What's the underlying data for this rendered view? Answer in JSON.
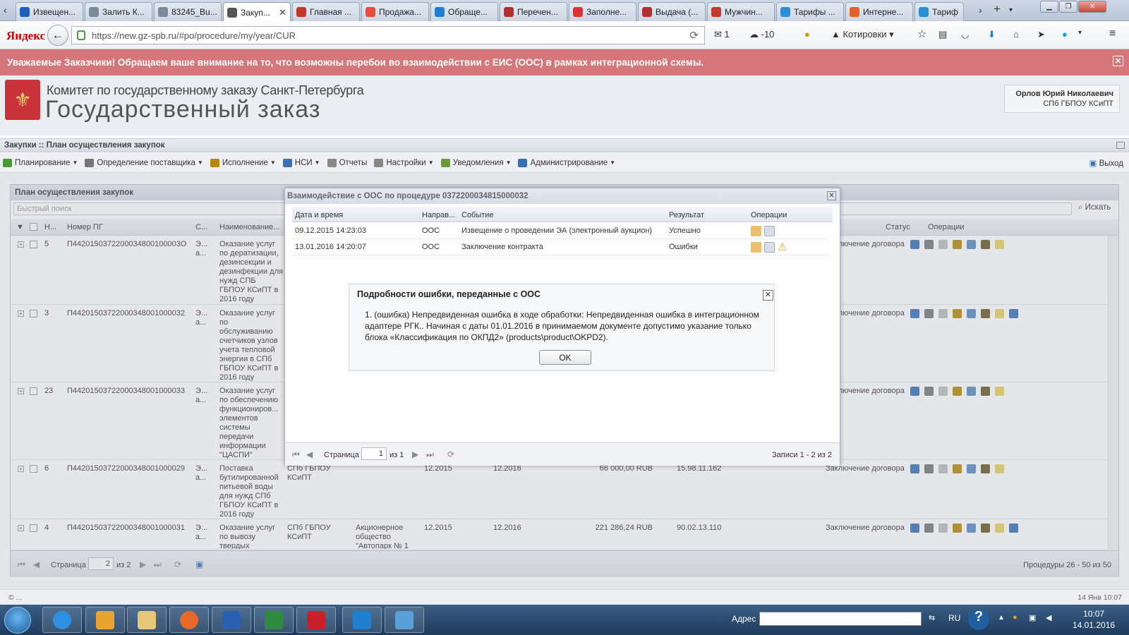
{
  "browser": {
    "tabs": [
      {
        "label": "Извещен...",
        "color": "#1f5fbf"
      },
      {
        "label": "Залить К...",
        "color": "#7a8a99"
      },
      {
        "label": "83245_Bu...",
        "color": "#7a8a99"
      },
      {
        "label": "Закуп...",
        "color": "#555"
      },
      {
        "label": "Главная ...",
        "color": "#c0392b"
      },
      {
        "label": "Продажа...",
        "color": "#e74c3c"
      },
      {
        "label": "Обраще...",
        "color": "#1f7fd1"
      },
      {
        "label": "Перечен...",
        "color": "#b03030"
      },
      {
        "label": "Заполне...",
        "color": "#d33"
      },
      {
        "label": "Выдача (...",
        "color": "#b03030"
      },
      {
        "label": "Мужчин...",
        "color": "#c0392b"
      },
      {
        "label": "Тарифы ...",
        "color": "#2a8fd4"
      },
      {
        "label": "Интерне...",
        "color": "#e0622a"
      },
      {
        "label": "Тариф",
        "color": "#2a8fd4"
      }
    ],
    "url": "https://new.gz-spb.ru/#po/procedure/my/year/CUR",
    "url_host": "new.gz-spb.ru",
    "brand": "Яндекс",
    "toolbar": {
      "mail_count": "1",
      "weather": "-10",
      "quotes": "Котировки"
    }
  },
  "banner": {
    "text": "Уважаемые Заказчики! Обращаем ваше внимание на то, что возможны перебои во взаимодействии с ЕИС (ООС) в рамках интеграционной схемы."
  },
  "header": {
    "org_line1": "Комитет по государственному заказу Санкт-Петербурга",
    "org_line2": "Государственный заказ",
    "user_name": "Орлов Юрий Николаевич",
    "user_org": "СПб ГБПОУ КСиПТ"
  },
  "breadcrumb": "Закупки :: План осуществления закупок",
  "menu": [
    {
      "label": "Планирование",
      "dropdown": true,
      "color": "#4a9a3a"
    },
    {
      "label": "Определение поставщика",
      "dropdown": true,
      "color": "#777"
    },
    {
      "label": "Исполнение",
      "dropdown": true,
      "color": "#b8860b"
    },
    {
      "label": "НСИ",
      "dropdown": true,
      "color": "#3a6fb0"
    },
    {
      "label": "Отчеты",
      "dropdown": false,
      "color": "#888"
    },
    {
      "label": "Настройки",
      "dropdown": true,
      "color": "#888"
    },
    {
      "label": "Уведомления",
      "dropdown": true,
      "color": "#6a9a3a"
    },
    {
      "label": "Администрирование",
      "dropdown": true,
      "color": "#3a6fb0"
    }
  ],
  "exit_label": "Выход",
  "main": {
    "title": "План осуществления закупок",
    "search_placeholder": "Быстрый поиск",
    "search_button": "Искать",
    "columns": {
      "n": "Н...",
      "pg": "Номер ПГ",
      "s": "С...",
      "name": "Наименование...",
      "status": "Статус",
      "ops": "Операции"
    },
    "rows": [
      {
        "n": "5",
        "pg": "П4420150372200034800100003О",
        "s": "Э... а...",
        "name": "Оказание услуг по дератизации, дезинсекции и дезинфекции для нужд СПБ ГБПОУ КСиПТ в 2016 году",
        "cust": "",
        "supplier": "",
        "start": "",
        "end": "",
        "sum": "",
        "okpd": "",
        "status": "Заключение договора",
        "extra_icon": false
      },
      {
        "n": "3",
        "pg": "П44201503722000348001000032",
        "s": "Э... а...",
        "name": "Оказание услуг по обслуживанию счетчиков узлов учета тепловой энергии в СПб ГБПОУ КСиПТ в 2016 году",
        "cust": "",
        "supplier": "",
        "start": "",
        "end": "",
        "sum": "",
        "okpd": "",
        "status": "Заключение договора",
        "extra_icon": true
      },
      {
        "n": "23",
        "pg": "П44201503722000348001000033",
        "s": "Э... а...",
        "name": "Оказание услуг по обеспечению функциониров... элементов системы передачи информации \"ЦАСПИ\"",
        "cust": "",
        "supplier": "",
        "start": "",
        "end": "",
        "sum": "",
        "okpd": "",
        "status": "Заключение договора",
        "extra_icon": false
      },
      {
        "n": "6",
        "pg": "П44201503722000348001000029",
        "s": "Э... а...",
        "name": "Поставка бутилированной питьевой воды для нужд СПб ГБПОУ КСиПТ в 2016 году",
        "cust": "СПб ГБПОУ КСиПТ",
        "supplier": "",
        "start": "12.2015",
        "end": "12.2016",
        "sum": "66 000,00 RUB",
        "okpd": "15.98.11.162",
        "status": "Заключение договора",
        "extra_icon": false
      },
      {
        "n": "4",
        "pg": "П44201503722000348001000031",
        "s": "Э... а...",
        "name": "Оказание услуг по вывозу твердых",
        "cust": "СПб ГБПОУ КСиПТ",
        "supplier": "Акционерное общество \"Автопарк № 1",
        "start": "12.2015",
        "end": "12.2016",
        "sum": "221 286,24 RUB",
        "okpd": "90.02.13.110",
        "status": "Заключение договора",
        "extra_icon": true
      }
    ],
    "pager": {
      "page_label": "Страница",
      "page": "2",
      "of": "из 2",
      "records": "Процедуры 26 - 50 из 50"
    }
  },
  "interaction": {
    "title": "Взаимодействие с ООС по процедуре 0372200034815000032",
    "columns": {
      "dt": "Дата и время",
      "dir": "Направ...",
      "event": "Событие",
      "result": "Результат",
      "ops": "Операции"
    },
    "rows": [
      {
        "dt": "09.12.2015 14:23:03",
        "dir": "ООС",
        "event": "Извещение о проведении ЭА (электронный аукцион)",
        "result": "Успешно",
        "warn": false
      },
      {
        "dt": "13.01.2016 14:20:07",
        "dir": "ООС",
        "event": "Заключение контракта",
        "result": "Ошибки",
        "warn": true
      }
    ],
    "pager": {
      "page_label": "Страница",
      "page": "1",
      "of": "из 1",
      "records": "Записи 1 - 2 из 2"
    }
  },
  "error_dialog": {
    "title": "Подробности ошибки, переданные с ООС",
    "text": "1. (ошибка) Непредвиденная ошибка в ходе обработки: Непредвиденная ошибка в интеграционном адаптере РГК.. Начиная с даты 01.01.2016 в принимаемом документе допустимо указание только блока «Классификация по ОКПД2» (products\\product\\OKPD2).",
    "ok_label": "OK"
  },
  "footer": {
    "left": "© ...",
    "right": "14 Янв 10:07"
  },
  "taskbar": {
    "address_label": "Адрес",
    "lang": "RU",
    "time": "10:07",
    "date": "14.01.2016"
  }
}
